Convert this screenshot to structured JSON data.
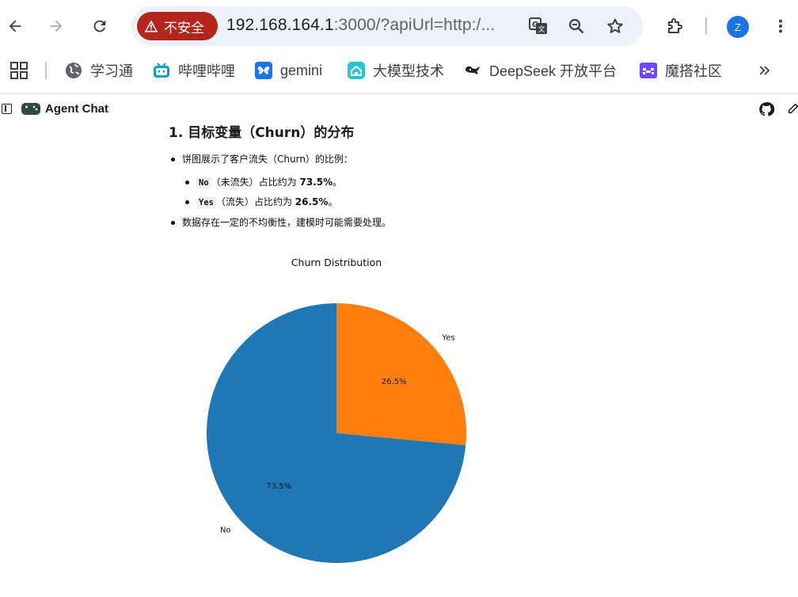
{
  "browser": {
    "security_chip": "不安全",
    "url_host": "192.168.164.1",
    "url_rest": ":3000/?apiUrl=http:/...",
    "profile_initial": "Z"
  },
  "bookmarks": [
    {
      "label": "学习通",
      "icon": "globe-icon"
    },
    {
      "label": "哔哩哔哩",
      "icon": "bilibili-icon",
      "color": "#00a1d6"
    },
    {
      "label": "gemini",
      "icon": "butterfly-icon",
      "color": "#1a73e8"
    },
    {
      "label": "大模型技术",
      "icon": "house-icon",
      "color": "#26c6da"
    },
    {
      "label": "DeepSeek 开放平台",
      "icon": "whale-icon"
    },
    {
      "label": "魔搭社区",
      "icon": "modelscope-icon",
      "color": "#6d4aff"
    }
  ],
  "app": {
    "title": "Agent Chat"
  },
  "message": {
    "heading": "1. 目标变量（Churn）的分布",
    "bullet1": "饼图展示了客户流失（Churn）的比例：",
    "sub1_code": "No",
    "sub1_text": "（未流失）占比约为 ",
    "sub1_value": "73.5%",
    "sub1_end": "。",
    "sub2_code": "Yes",
    "sub2_text": "（流失）占比约为 ",
    "sub2_value": "26.5%",
    "sub2_end": "。",
    "bullet2": "数据存在一定的不均衡性，建模时可能需要处理。"
  },
  "chart_data": {
    "type": "pie",
    "title": "Churn Distribution",
    "categories": [
      "Yes",
      "No"
    ],
    "values": [
      26.5,
      73.5
    ],
    "labels_pct": [
      "26.5%",
      "73.5%"
    ],
    "colors": [
      "#ff7f0e",
      "#1f77b4"
    ],
    "start_angle_deg": 90,
    "direction": "clockwise"
  }
}
